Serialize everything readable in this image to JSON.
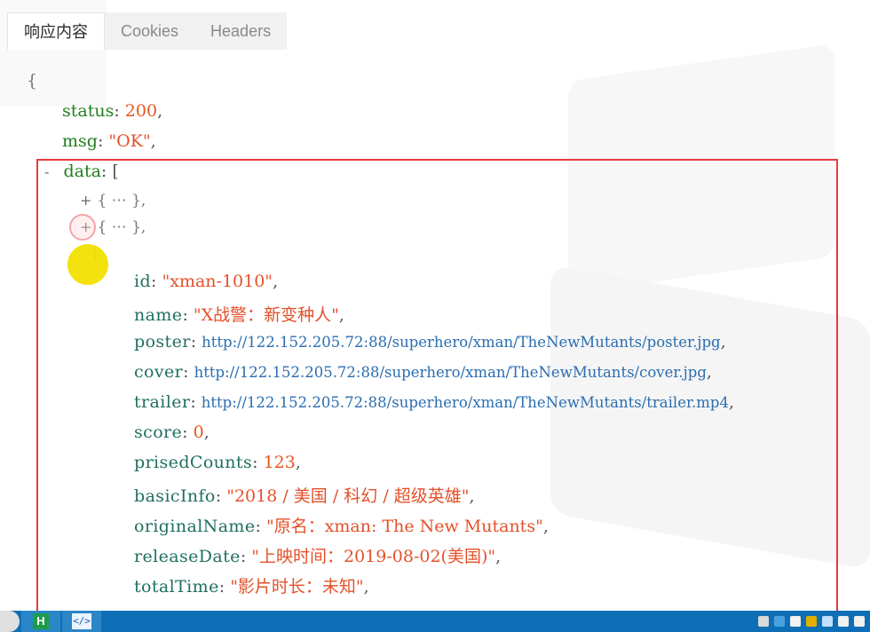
{
  "tabs": [
    {
      "label": "响应内容"
    },
    {
      "label": "Cookies"
    },
    {
      "label": "Headers"
    }
  ],
  "json": {
    "open_brace": "{",
    "status_key": "status",
    "status_value": "200",
    "msg_key": "msg",
    "msg_value": "\"OK\"",
    "data_key": "data",
    "collapsed_item": "{ ⋯ },",
    "toggle_collapse": "-",
    "toggle_expand": "+",
    "fields": [
      {
        "key": "id",
        "value": "\"xman-1010\"",
        "kind": "str"
      },
      {
        "key": "name",
        "value": "\"X战警：新变种人\"",
        "kind": "str"
      },
      {
        "key": "poster",
        "value": "http://122.152.205.72:88/superhero/xman/TheNewMutants/poster.jpg",
        "kind": "url"
      },
      {
        "key": "cover",
        "value": "http://122.152.205.72:88/superhero/xman/TheNewMutants/cover.jpg",
        "kind": "url"
      },
      {
        "key": "trailer",
        "value": "http://122.152.205.72:88/superhero/xman/TheNewMutants/trailer.mp4",
        "kind": "url"
      },
      {
        "key": "score",
        "value": "0",
        "kind": "num"
      },
      {
        "key": "prisedCounts",
        "value": "123",
        "kind": "num"
      },
      {
        "key": "basicInfo",
        "value": "\"2018 / 美国 / 科幻 / 超级英雄\"",
        "kind": "str"
      },
      {
        "key": "originalName",
        "value": "\"原名：xman: The New Mutants\"",
        "kind": "str"
      },
      {
        "key": "releaseDate",
        "value": "\"上映时间：2019-08-02(美国)\"",
        "kind": "str"
      },
      {
        "key": "totalTime",
        "value": "\"影片时长：未知\"",
        "kind": "str"
      }
    ]
  },
  "taskbar": {
    "app_h_label": "H",
    "app_code_label": "</>"
  },
  "colors": {
    "highlight_box": "#e53940",
    "key": "#1f7f1f",
    "string": "#e4512a",
    "url": "#2b6db0",
    "taskbar": "#0f6fb6"
  }
}
